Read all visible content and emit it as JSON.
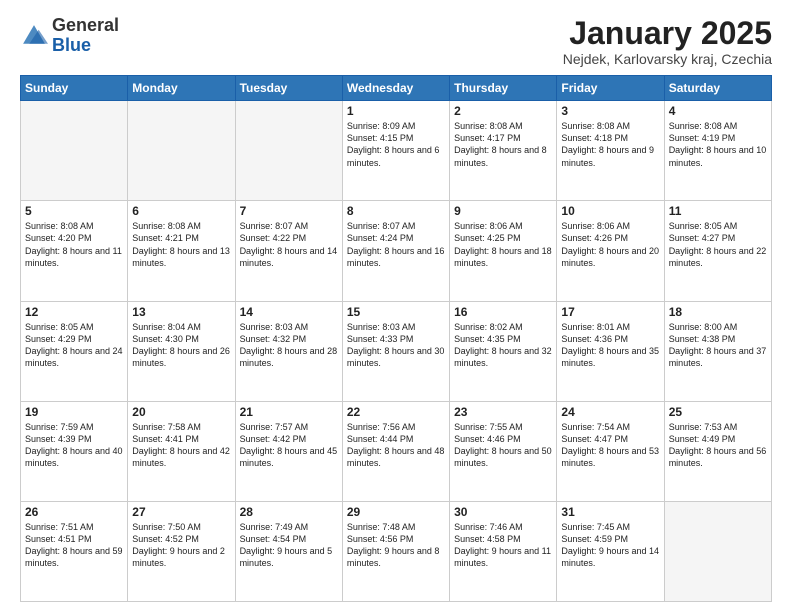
{
  "header": {
    "logo_general": "General",
    "logo_blue": "Blue",
    "month_title": "January 2025",
    "subtitle": "Nejdek, Karlovarsky kraj, Czechia"
  },
  "days_of_week": [
    "Sunday",
    "Monday",
    "Tuesday",
    "Wednesday",
    "Thursday",
    "Friday",
    "Saturday"
  ],
  "weeks": [
    [
      {
        "num": "",
        "info": ""
      },
      {
        "num": "",
        "info": ""
      },
      {
        "num": "",
        "info": ""
      },
      {
        "num": "1",
        "info": "Sunrise: 8:09 AM\nSunset: 4:15 PM\nDaylight: 8 hours and 6 minutes."
      },
      {
        "num": "2",
        "info": "Sunrise: 8:08 AM\nSunset: 4:17 PM\nDaylight: 8 hours and 8 minutes."
      },
      {
        "num": "3",
        "info": "Sunrise: 8:08 AM\nSunset: 4:18 PM\nDaylight: 8 hours and 9 minutes."
      },
      {
        "num": "4",
        "info": "Sunrise: 8:08 AM\nSunset: 4:19 PM\nDaylight: 8 hours and 10 minutes."
      }
    ],
    [
      {
        "num": "5",
        "info": "Sunrise: 8:08 AM\nSunset: 4:20 PM\nDaylight: 8 hours and 11 minutes."
      },
      {
        "num": "6",
        "info": "Sunrise: 8:08 AM\nSunset: 4:21 PM\nDaylight: 8 hours and 13 minutes."
      },
      {
        "num": "7",
        "info": "Sunrise: 8:07 AM\nSunset: 4:22 PM\nDaylight: 8 hours and 14 minutes."
      },
      {
        "num": "8",
        "info": "Sunrise: 8:07 AM\nSunset: 4:24 PM\nDaylight: 8 hours and 16 minutes."
      },
      {
        "num": "9",
        "info": "Sunrise: 8:06 AM\nSunset: 4:25 PM\nDaylight: 8 hours and 18 minutes."
      },
      {
        "num": "10",
        "info": "Sunrise: 8:06 AM\nSunset: 4:26 PM\nDaylight: 8 hours and 20 minutes."
      },
      {
        "num": "11",
        "info": "Sunrise: 8:05 AM\nSunset: 4:27 PM\nDaylight: 8 hours and 22 minutes."
      }
    ],
    [
      {
        "num": "12",
        "info": "Sunrise: 8:05 AM\nSunset: 4:29 PM\nDaylight: 8 hours and 24 minutes."
      },
      {
        "num": "13",
        "info": "Sunrise: 8:04 AM\nSunset: 4:30 PM\nDaylight: 8 hours and 26 minutes."
      },
      {
        "num": "14",
        "info": "Sunrise: 8:03 AM\nSunset: 4:32 PM\nDaylight: 8 hours and 28 minutes."
      },
      {
        "num": "15",
        "info": "Sunrise: 8:03 AM\nSunset: 4:33 PM\nDaylight: 8 hours and 30 minutes."
      },
      {
        "num": "16",
        "info": "Sunrise: 8:02 AM\nSunset: 4:35 PM\nDaylight: 8 hours and 32 minutes."
      },
      {
        "num": "17",
        "info": "Sunrise: 8:01 AM\nSunset: 4:36 PM\nDaylight: 8 hours and 35 minutes."
      },
      {
        "num": "18",
        "info": "Sunrise: 8:00 AM\nSunset: 4:38 PM\nDaylight: 8 hours and 37 minutes."
      }
    ],
    [
      {
        "num": "19",
        "info": "Sunrise: 7:59 AM\nSunset: 4:39 PM\nDaylight: 8 hours and 40 minutes."
      },
      {
        "num": "20",
        "info": "Sunrise: 7:58 AM\nSunset: 4:41 PM\nDaylight: 8 hours and 42 minutes."
      },
      {
        "num": "21",
        "info": "Sunrise: 7:57 AM\nSunset: 4:42 PM\nDaylight: 8 hours and 45 minutes."
      },
      {
        "num": "22",
        "info": "Sunrise: 7:56 AM\nSunset: 4:44 PM\nDaylight: 8 hours and 48 minutes."
      },
      {
        "num": "23",
        "info": "Sunrise: 7:55 AM\nSunset: 4:46 PM\nDaylight: 8 hours and 50 minutes."
      },
      {
        "num": "24",
        "info": "Sunrise: 7:54 AM\nSunset: 4:47 PM\nDaylight: 8 hours and 53 minutes."
      },
      {
        "num": "25",
        "info": "Sunrise: 7:53 AM\nSunset: 4:49 PM\nDaylight: 8 hours and 56 minutes."
      }
    ],
    [
      {
        "num": "26",
        "info": "Sunrise: 7:51 AM\nSunset: 4:51 PM\nDaylight: 8 hours and 59 minutes."
      },
      {
        "num": "27",
        "info": "Sunrise: 7:50 AM\nSunset: 4:52 PM\nDaylight: 9 hours and 2 minutes."
      },
      {
        "num": "28",
        "info": "Sunrise: 7:49 AM\nSunset: 4:54 PM\nDaylight: 9 hours and 5 minutes."
      },
      {
        "num": "29",
        "info": "Sunrise: 7:48 AM\nSunset: 4:56 PM\nDaylight: 9 hours and 8 minutes."
      },
      {
        "num": "30",
        "info": "Sunrise: 7:46 AM\nSunset: 4:58 PM\nDaylight: 9 hours and 11 minutes."
      },
      {
        "num": "31",
        "info": "Sunrise: 7:45 AM\nSunset: 4:59 PM\nDaylight: 9 hours and 14 minutes."
      },
      {
        "num": "",
        "info": ""
      }
    ]
  ]
}
